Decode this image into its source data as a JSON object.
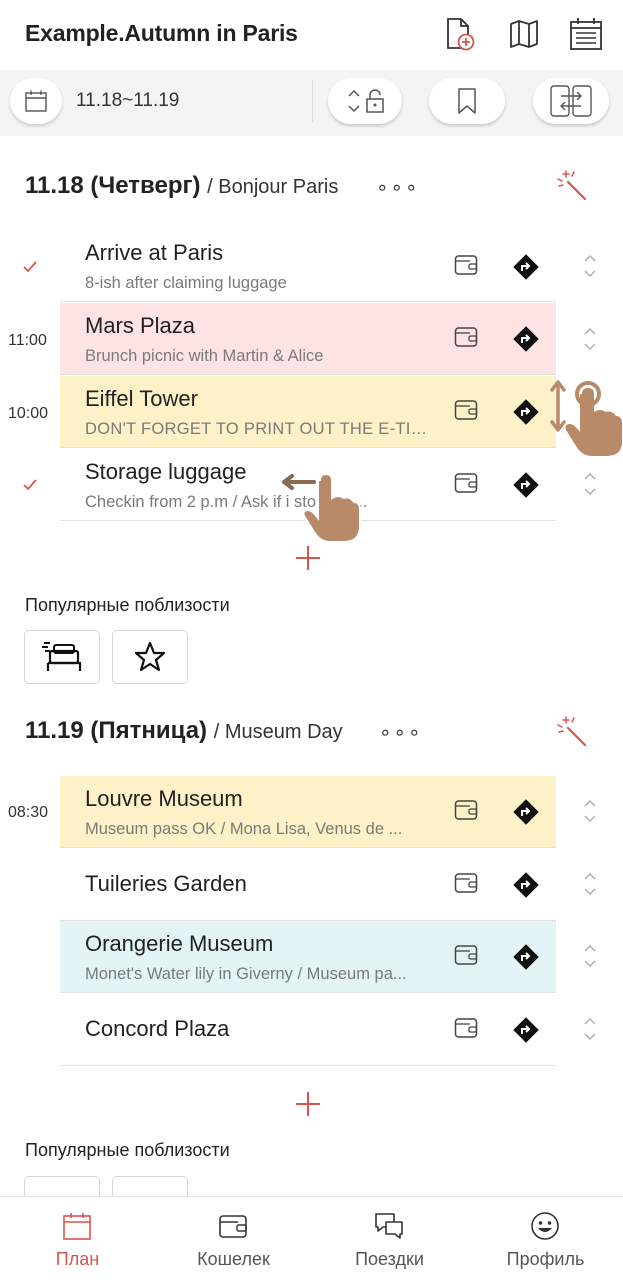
{
  "header": {
    "title": "Example.Autumn in Paris",
    "icons": [
      "new-document-icon",
      "map-icon",
      "calendar-list-icon"
    ]
  },
  "toolbar": {
    "calendar_icon": "calendar-icon",
    "date_range": "11.18~11.19",
    "lock_icon": "sort-lock-icon",
    "bookmark_icon": "bookmark-icon",
    "swap_icon": "swap-view-icon"
  },
  "days": [
    {
      "date": "11.18",
      "day_name": "(Четверг)",
      "subtitle": "/ Bonjour Paris",
      "more": "∘∘∘",
      "items": [
        {
          "time": "",
          "checked": true,
          "title": "Arrive at Paris",
          "subtitle": "8-ish after claiming luggage",
          "color": ""
        },
        {
          "time": "11:00",
          "checked": false,
          "title": "Mars Plaza",
          "subtitle": "Brunch picnic with Martin & Alice",
          "color": "#fde3e3"
        },
        {
          "time": "10:00",
          "checked": false,
          "title": "Eiffel Tower",
          "subtitle": "DON'T FORGET TO PRINT OUT THE E-TIC...",
          "color": "#fdf1c8"
        },
        {
          "time": "",
          "checked": true,
          "title": "Storage luggage",
          "subtitle": "Checkin from 2 p.m / Ask if i  storage ...",
          "color": ""
        }
      ],
      "nearby_label": "Популярные поблизости"
    },
    {
      "date": "11.19",
      "day_name": "(Пятница)",
      "subtitle": "/ Museum Day",
      "more": "∘∘∘",
      "items": [
        {
          "time": "08:30",
          "checked": false,
          "title": "Louvre Museum",
          "subtitle": "Museum pass OK / Mona Lisa, Venus de ...",
          "color": "#fdf1c8"
        },
        {
          "time": "",
          "checked": false,
          "title": "Tuileries Garden",
          "subtitle": "",
          "color": ""
        },
        {
          "time": "",
          "checked": false,
          "title": "Orangerie Museum",
          "subtitle": "Monet's Water lily in Giverny / Museum pa...",
          "color": "#e2f4f6"
        },
        {
          "time": "",
          "checked": false,
          "title": "Concord Plaza",
          "subtitle": "",
          "color": ""
        }
      ],
      "nearby_label": "Популярные поблизости"
    }
  ],
  "bottom_nav": [
    {
      "label": "План",
      "icon": "plan-calendar-icon",
      "active": true
    },
    {
      "label": "Кошелек",
      "icon": "wallet-icon",
      "active": false
    },
    {
      "label": "Поездки",
      "icon": "chat-bubbles-icon",
      "active": false
    },
    {
      "label": "Профиль",
      "icon": "smiley-icon",
      "active": false
    }
  ],
  "colors": {
    "accent": "#d9534f",
    "pink": "#fde3e3",
    "yellow": "#fdf1c8",
    "cyan": "#e2f4f6",
    "gesture": "#b98a6a"
  }
}
